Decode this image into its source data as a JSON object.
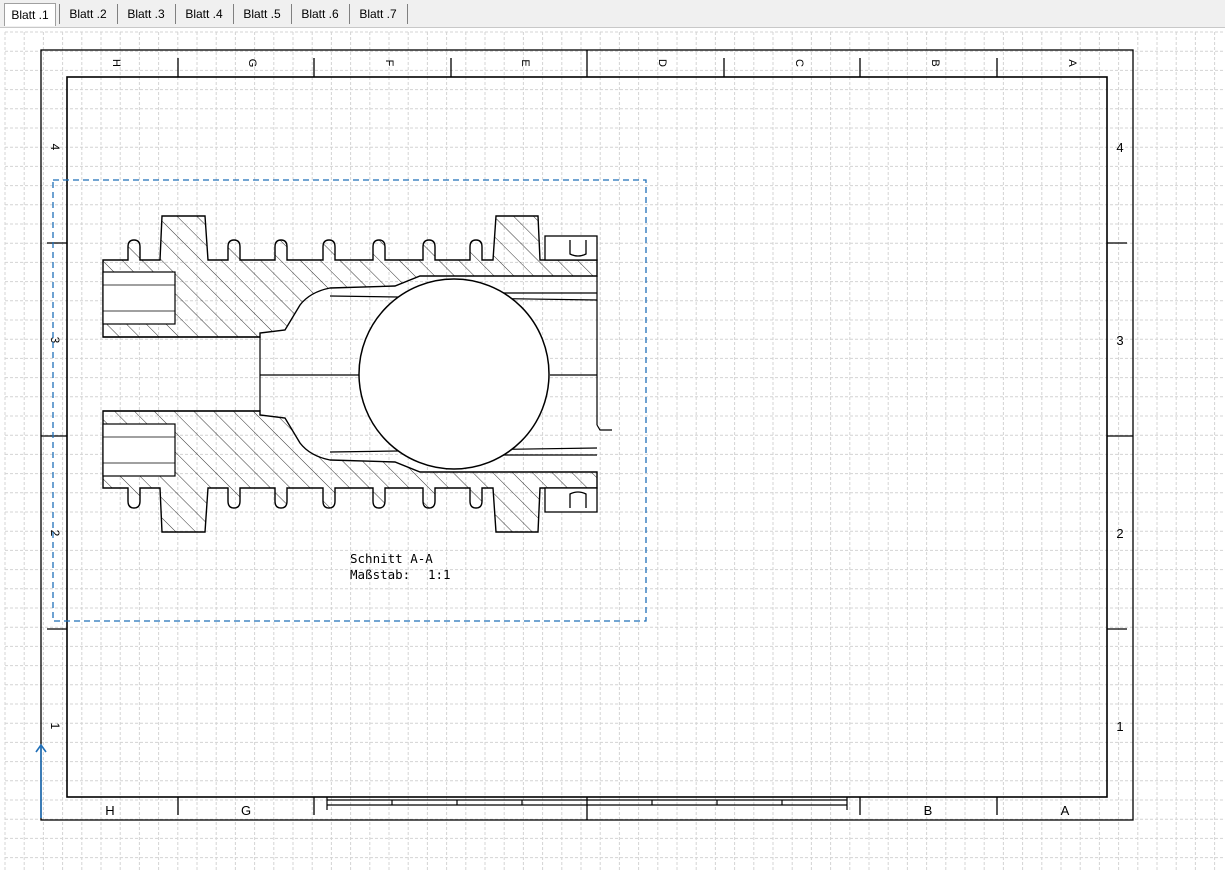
{
  "tabs": [
    "Blatt .1",
    "Blatt .2",
    "Blatt .3",
    "Blatt .4",
    "Blatt .5",
    "Blatt .6",
    "Blatt .7"
  ],
  "active_tab_index": 0,
  "zones_top": [
    "H",
    "G",
    "F",
    "E",
    "D",
    "C",
    "B",
    "A"
  ],
  "zones_bottom": [
    "H",
    "G",
    "B",
    "A"
  ],
  "rows_left": [
    "4",
    "3",
    "2",
    "1"
  ],
  "rows_right": [
    "4",
    "3",
    "2",
    "1"
  ],
  "view": {
    "title": "Schnitt A-A",
    "scale_label": "Maßstab:",
    "scale_value": "1:1"
  },
  "colors": {
    "selection": "#1f6fb8",
    "grid": "#d4d4d4",
    "frame": "#000000",
    "axis_arrow": "#1f6fb8"
  }
}
